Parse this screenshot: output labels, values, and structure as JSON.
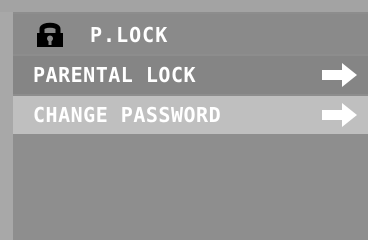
{
  "header": {
    "icon": "lock-icon",
    "title": "P.LOCK"
  },
  "menu": {
    "items": [
      {
        "label": "PARENTAL LOCK",
        "icon": "arrow-right-icon",
        "selected": false
      },
      {
        "label": "CHANGE PASSWORD",
        "icon": "arrow-right-icon",
        "selected": true
      }
    ]
  },
  "colors": {
    "text": "#ffffff",
    "highlight": "#bfbfbf",
    "panel": "#8d8d8d"
  }
}
